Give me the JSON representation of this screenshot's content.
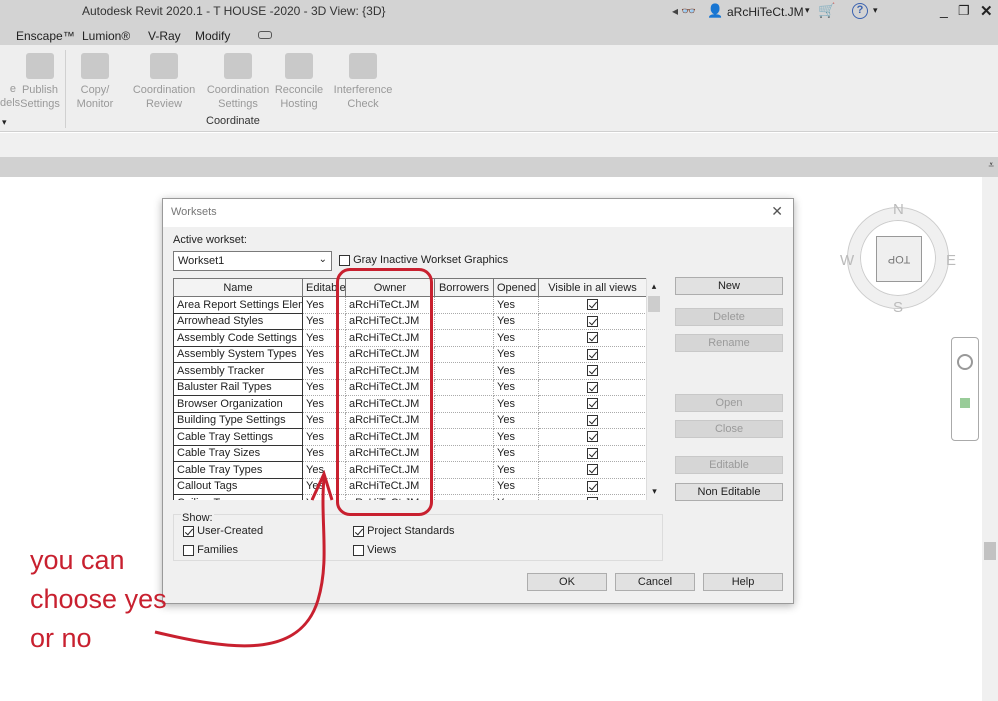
{
  "app": {
    "title": "Autodesk Revit 2020.1 - T HOUSE -2020 - 3D View: {3D}",
    "user": "aRcHiTeCt.JM"
  },
  "menu": [
    "Enscape™",
    "Lumion®",
    "V-Ray",
    "Modify"
  ],
  "ribbon": {
    "items": [
      {
        "label1": "Publish",
        "label2": "Settings"
      },
      {
        "label1": "Copy/",
        "label2": "Monitor"
      },
      {
        "label1": "Coordination",
        "label2": "Review"
      },
      {
        "label1": "Coordination",
        "label2": "Settings"
      },
      {
        "label1": "Reconcile",
        "label2": "Hosting"
      },
      {
        "label1": "Interference",
        "label2": "Check"
      }
    ],
    "partial1": "e",
    "partial2": "dels",
    "group": "Coordinate"
  },
  "viewcube": {
    "face": "TOP",
    "n": "N",
    "s": "S",
    "e": "E",
    "w": "W"
  },
  "dialog": {
    "title": "Worksets",
    "active_label": "Active workset:",
    "active_value": "Workset1",
    "gray_label": "Gray Inactive Workset Graphics",
    "columns": [
      "Name",
      "Editable",
      "Owner",
      "Borrowers",
      "Opened",
      "Visible in all views"
    ],
    "rows": [
      {
        "name": "Area Report Settings Elem",
        "editable": "Yes",
        "owner": "aRcHiTeCt.JM",
        "borrowers": "",
        "opened": "Yes",
        "visible": true
      },
      {
        "name": "Arrowhead Styles",
        "editable": "Yes",
        "owner": "aRcHiTeCt.JM",
        "borrowers": "",
        "opened": "Yes",
        "visible": true
      },
      {
        "name": "Assembly Code Settings",
        "editable": "Yes",
        "owner": "aRcHiTeCt.JM",
        "borrowers": "",
        "opened": "Yes",
        "visible": true
      },
      {
        "name": "Assembly System Types",
        "editable": "Yes",
        "owner": "aRcHiTeCt.JM",
        "borrowers": "",
        "opened": "Yes",
        "visible": true
      },
      {
        "name": "Assembly Tracker",
        "editable": "Yes",
        "owner": "aRcHiTeCt.JM",
        "borrowers": "",
        "opened": "Yes",
        "visible": true
      },
      {
        "name": "Baluster Rail Types",
        "editable": "Yes",
        "owner": "aRcHiTeCt.JM",
        "borrowers": "",
        "opened": "Yes",
        "visible": true
      },
      {
        "name": "Browser Organization",
        "editable": "Yes",
        "owner": "aRcHiTeCt.JM",
        "borrowers": "",
        "opened": "Yes",
        "visible": true
      },
      {
        "name": "Building Type Settings",
        "editable": "Yes",
        "owner": "aRcHiTeCt.JM",
        "borrowers": "",
        "opened": "Yes",
        "visible": true
      },
      {
        "name": "Cable Tray Settings",
        "editable": "Yes",
        "owner": "aRcHiTeCt.JM",
        "borrowers": "",
        "opened": "Yes",
        "visible": true
      },
      {
        "name": "Cable Tray Sizes",
        "editable": "Yes",
        "owner": "aRcHiTeCt.JM",
        "borrowers": "",
        "opened": "Yes",
        "visible": true
      },
      {
        "name": "Cable Tray Types",
        "editable": "Yes",
        "owner": "aRcHiTeCt.JM",
        "borrowers": "",
        "opened": "Yes",
        "visible": true
      },
      {
        "name": "Callout Tags",
        "editable": "Yes",
        "owner": "aRcHiTeCt.JM",
        "borrowers": "",
        "opened": "Yes",
        "visible": true
      },
      {
        "name": "Ceiling Types",
        "editable": "Yes",
        "owner": "aRcHiTeCt.JM",
        "borrowers": "",
        "opened": "Yes",
        "visible": true
      }
    ],
    "buttons": {
      "new": "New",
      "delete": "Delete",
      "rename": "Rename",
      "open": "Open",
      "close": "Close",
      "editable": "Editable",
      "non_editable": "Non Editable"
    },
    "show": {
      "label": "Show:",
      "user_created": "User-Created",
      "families": "Families",
      "project_standards": "Project Standards",
      "views": "Views"
    },
    "ok": "OK",
    "cancel": "Cancel",
    "help": "Help"
  },
  "annotation": {
    "line1": "you can",
    "line2": "choose yes",
    "line3": "or no",
    "color": "#c8202f"
  }
}
